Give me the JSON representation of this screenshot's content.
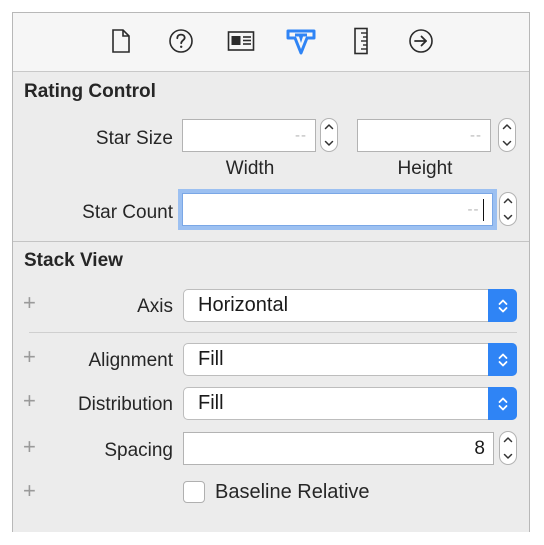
{
  "tabs": [
    {
      "name": "file-inspector",
      "icon": "document-icon",
      "selected": false
    },
    {
      "name": "quick-help",
      "icon": "question-circle-icon",
      "selected": false
    },
    {
      "name": "identity-inspector",
      "icon": "identity-card-icon",
      "selected": false
    },
    {
      "name": "attributes-inspector",
      "icon": "attributes-shield-icon",
      "selected": true
    },
    {
      "name": "size-inspector",
      "icon": "ruler-icon",
      "selected": false
    },
    {
      "name": "connections-inspector",
      "icon": "arrow-circle-icon",
      "selected": false
    }
  ],
  "accent_color": "#2f84f5",
  "rating_control": {
    "title": "Rating Control",
    "star_size_label": "Star Size",
    "width_placeholder": "--",
    "height_placeholder": "--",
    "width_label": "Width",
    "height_label": "Height",
    "star_count_label": "Star Count",
    "star_count_placeholder": "--"
  },
  "stack_view": {
    "title": "Stack View",
    "axis_label": "Axis",
    "axis_value": "Horizontal",
    "alignment_label": "Alignment",
    "alignment_value": "Fill",
    "distribution_label": "Distribution",
    "distribution_value": "Fill",
    "spacing_label": "Spacing",
    "spacing_value": "8",
    "baseline_label": "Baseline Relative",
    "baseline_checked": false,
    "plus_symbol": "+"
  }
}
